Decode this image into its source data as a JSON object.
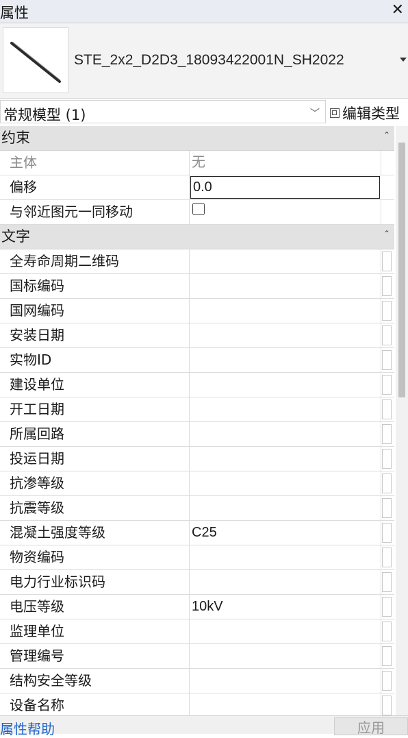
{
  "window": {
    "title": "属性",
    "close_icon": "close-icon"
  },
  "type_selector": {
    "name": "STE_2x2_D2D3_18093422001N_SH2022",
    "thumbnail_icon": "pipe-model-icon"
  },
  "filter": {
    "value": "常规模型 (1)",
    "edit_type_label": "编辑类型"
  },
  "groups": [
    {
      "title": "约束",
      "rows": [
        {
          "name": "主体",
          "value": "无"
        },
        {
          "name": "偏移",
          "value": "0.0"
        },
        {
          "name": "与邻近图元一同移动",
          "value": ""
        }
      ]
    },
    {
      "title": "文字",
      "rows": [
        {
          "name": "全寿命周期二维码",
          "value": ""
        },
        {
          "name": "国标编码",
          "value": ""
        },
        {
          "name": "国网编码",
          "value": ""
        },
        {
          "name": "安装日期",
          "value": ""
        },
        {
          "name": "实物ID",
          "value": ""
        },
        {
          "name": "建设单位",
          "value": ""
        },
        {
          "name": "开工日期",
          "value": ""
        },
        {
          "name": "所属回路",
          "value": ""
        },
        {
          "name": "投运日期",
          "value": ""
        },
        {
          "name": "抗渗等级",
          "value": ""
        },
        {
          "name": "抗震等级",
          "value": ""
        },
        {
          "name": "混凝土强度等级",
          "value": "C25"
        },
        {
          "name": "物资编码",
          "value": ""
        },
        {
          "name": "电力行业标识码",
          "value": ""
        },
        {
          "name": "电压等级",
          "value": "10kV"
        },
        {
          "name": "监理单位",
          "value": ""
        },
        {
          "name": "管理编号",
          "value": ""
        },
        {
          "name": "结构安全等级",
          "value": ""
        },
        {
          "name": "设备名称",
          "value": ""
        }
      ]
    }
  ],
  "footer": {
    "help_label": "属性帮助",
    "apply_label": "应用"
  },
  "colors": {
    "link": "#1e64c8",
    "group_bg": "#e2e2e2",
    "title_bg": "#e9ecf2"
  }
}
